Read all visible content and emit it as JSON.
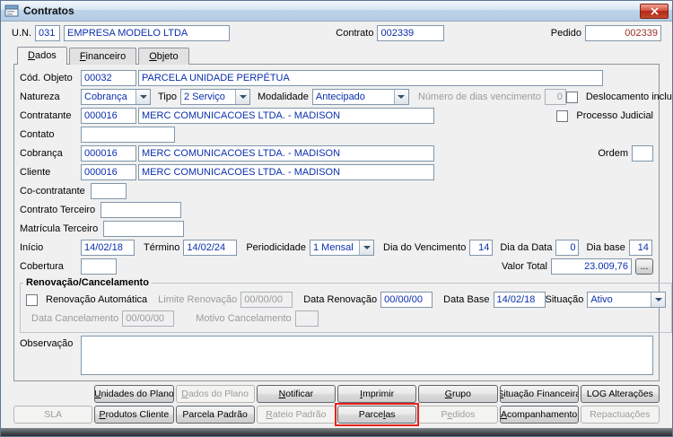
{
  "colors": {
    "field_value_text": "#0a2fae",
    "pedido_value_text": "#9c2f26",
    "annotation_highlight": "#e8221c",
    "dialog_background": "#f0f0f0"
  },
  "window": {
    "title": "Contratos"
  },
  "header": {
    "un_label": "U.N.",
    "un_code": "031",
    "un_name": "EMPRESA MODELO LTDA",
    "contrato_label": "Contrato",
    "contrato_value": "002339",
    "pedido_label": "Pedido",
    "pedido_value": "002339"
  },
  "tabs": {
    "dados": "&Dados",
    "financeiro": "&Financeiro",
    "objeto": "&Objeto"
  },
  "form": {
    "cod_objeto_label": "Cód. Objeto",
    "cod_objeto_code": "00032",
    "cod_objeto_desc": "PARCELA UNIDADE PERPÉTUA",
    "natureza_label": "Natureza",
    "natureza_value": "Cobrança",
    "tipo_label": "Tipo",
    "tipo_value": "2 Serviço",
    "modalidade_label": "Modalidade",
    "modalidade_value": "Antecipado",
    "dias_vencimento_label": "Número de dias vencimento",
    "dias_vencimento_value": "0",
    "deslocamento_label": "Deslocamento incluso",
    "contratante_label": "Contratante",
    "contratante_code": "000016",
    "contratante_name": "MERC COMUNICACOES LTDA. - MADISON",
    "processo_judicial_label": "Processo Judicial",
    "contato_label": "Contato",
    "contato_value": "",
    "cobranca_label": "Cobrança",
    "cobranca_code": "000016",
    "cobranca_name": "MERC COMUNICACOES LTDA. - MADISON",
    "ordem_label": "Ordem",
    "ordem_value": "",
    "cliente_label": "Cliente",
    "cliente_code": "000016",
    "cliente_name": "MERC COMUNICACOES LTDA. - MADISON",
    "co_contratante_label": "Co-contratante",
    "co_contratante_value": "",
    "contrato_terceiro_label": "Contrato Terceiro",
    "contrato_terceiro_value": "",
    "matricula_terceiro_label": "Matrícula Terceiro",
    "matricula_terceiro_value": "",
    "inicio_label": "Início",
    "inicio_value": "14/02/18",
    "termino_label": "Término",
    "termino_value": "14/02/24",
    "periodicidade_label": "Periodicidade",
    "periodicidade_value": "1 Mensal",
    "dia_vencimento_label": "Dia do Vencimento",
    "dia_vencimento_value": "14",
    "dia_data_label": "Dia da Data",
    "dia_data_value": "0",
    "dia_base_label": "Dia base",
    "dia_base_value": "14",
    "cobertura_label": "Cobertura",
    "cobertura_value": "",
    "valor_total_label": "Valor Total",
    "valor_total_value": "23.009,76",
    "valor_total_button": "...",
    "observacao_label": "Observação",
    "observacao_value": ""
  },
  "renovacao": {
    "title": "Renovação/Cancelamento",
    "renovacao_automatica_label": "Renovação Automática",
    "limite_renovacao_label": "Limite Renovação",
    "limite_renovacao_value": "00/00/00",
    "data_renovacao_label": "Data Renovação",
    "data_renovacao_value": "00/00/00",
    "data_base_label": "Data Base",
    "data_base_value": "14/02/18",
    "situacao_label": "Situação",
    "situacao_value": "Ativo",
    "data_cancelamento_label": "Data Cancelamento",
    "data_cancelamento_value": "00/00/00",
    "motivo_cancelamento_label": "Motivo Cancelamento",
    "motivo_cancelamento_value": ""
  },
  "buttons": {
    "unidades_plano": "&Unidades do Plano",
    "dados_plano": "&Dados do Plano",
    "notificar": "&Notificar",
    "imprimir": "&Imprimir",
    "grupo": "&Grupo",
    "situacao_financeira": "&Situação Financeira",
    "log_alteracoes": "LOG Alterações",
    "sla": "SLA",
    "produtos_cliente": "&Produtos Cliente",
    "parcela_padrao": "Parcela Padrão",
    "rateio_padrao": "&Rateio Padrão",
    "parcelas": "Parce&las",
    "pedidos": "P&edidos",
    "acompanhamento": "&Acompanhamento",
    "repactuacoes": "Repactuações"
  }
}
